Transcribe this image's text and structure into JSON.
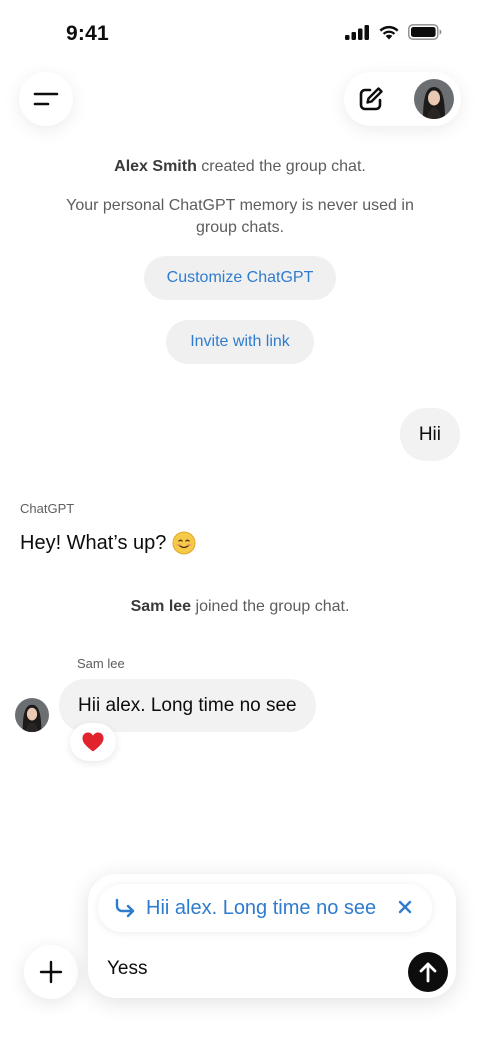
{
  "status_bar": {
    "time": "9:41",
    "icons": [
      "cellular-signal-icon",
      "wifi-icon",
      "battery-icon"
    ]
  },
  "top_bar": {
    "menu_icon": "menu-lines-icon",
    "compose_icon": "compose-icon",
    "avatar": "user-avatar"
  },
  "chat": {
    "created_name": "Alex Smith",
    "created_text": " created the group chat.",
    "memory_notice": "Your personal ChatGPT memory is never used in group chats.",
    "customize_label": "Customize ChatGPT",
    "invite_label": "Invite with link",
    "user_message": "Hii",
    "assistant_name": "ChatGPT",
    "assistant_message": "Hey! What’s up?",
    "assistant_emoji": "smiling-face-emoji",
    "joined_name": "Sam lee",
    "joined_text": " joined the group chat.",
    "other_sender": "Sam lee",
    "other_message": "Hii alex. Long time no see",
    "reaction": "❤️"
  },
  "composer": {
    "reply_to": "Hii alex. Long time no see",
    "input_value": "Yess",
    "plus_icon": "plus-icon",
    "send_icon": "arrow-up-icon"
  },
  "colors": {
    "accent": "#2f7ccf",
    "bubble": "#f2f2f2",
    "pill": "#f0f0f0",
    "text": "#0d0d0d"
  }
}
